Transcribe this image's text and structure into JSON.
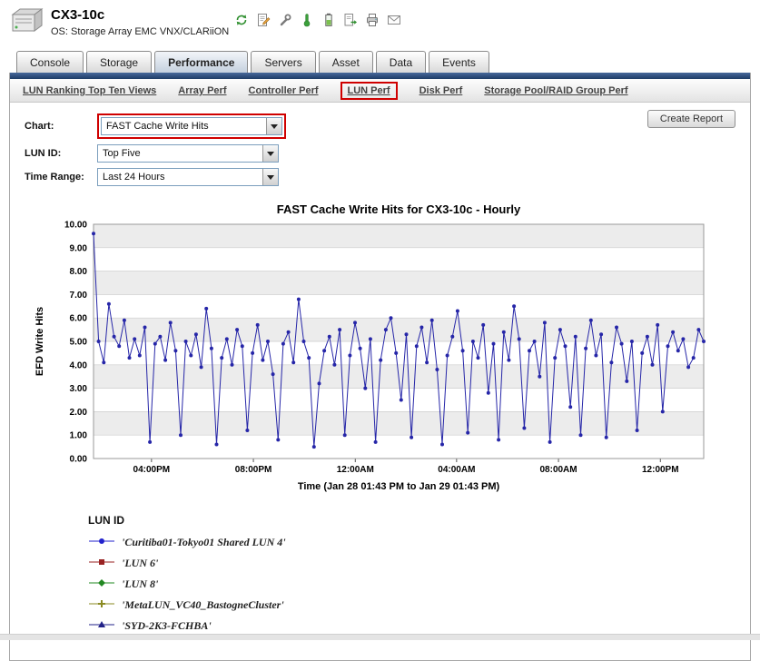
{
  "header": {
    "title": "CX3-10c",
    "subtitle": "OS: Storage Array EMC VNX/CLARiiON",
    "toolbar_icons": [
      "refresh-icon",
      "edit-report-icon",
      "tools-icon",
      "thermometer-icon",
      "battery-icon",
      "export-icon",
      "print-icon",
      "email-icon"
    ]
  },
  "tabs": [
    {
      "label": "Console",
      "active": false
    },
    {
      "label": "Storage",
      "active": false
    },
    {
      "label": "Performance",
      "active": true
    },
    {
      "label": "Servers",
      "active": false
    },
    {
      "label": "Asset",
      "active": false
    },
    {
      "label": "Data",
      "active": false
    },
    {
      "label": "Events",
      "active": false
    }
  ],
  "subnav": [
    {
      "label": "LUN Ranking Top Ten Views",
      "callout": false
    },
    {
      "label": "Array Perf",
      "callout": false
    },
    {
      "label": "Controller Perf",
      "callout": false
    },
    {
      "label": "LUN Perf",
      "callout": true
    },
    {
      "label": "Disk Perf",
      "callout": false
    },
    {
      "label": "Storage Pool/RAID Group Perf",
      "callout": false
    }
  ],
  "controls": {
    "rows": [
      {
        "name": "chart",
        "label": "Chart:",
        "value": "FAST Cache Write Hits",
        "callout": true
      },
      {
        "name": "lun-id",
        "label": "LUN ID:",
        "value": "Top Five",
        "callout": false
      },
      {
        "name": "time-range",
        "label": "Time Range:",
        "value": "Last 24 Hours",
        "callout": false
      }
    ],
    "create_report_label": "Create Report"
  },
  "chart_data": {
    "type": "line",
    "title": "FAST Cache Write Hits for CX3-10c - Hourly",
    "xlabel": "Time (Jan 28 01:43 PM to Jan 29 01:43 PM)",
    "ylabel": "EFD Write Hits",
    "ylim": [
      0,
      10
    ],
    "ytick_step": 1,
    "grid": true,
    "x_ticks": [
      {
        "label": "04:00PM",
        "pos": 0.095
      },
      {
        "label": "08:00PM",
        "pos": 0.262
      },
      {
        "label": "12:00AM",
        "pos": 0.429
      },
      {
        "label": "04:00AM",
        "pos": 0.595
      },
      {
        "label": "08:00AM",
        "pos": 0.762
      },
      {
        "label": "12:00PM",
        "pos": 0.929
      }
    ],
    "series": [
      {
        "name": "'Curitiba01-Tokyo01 Shared LUN 4'",
        "color": "#2626a8",
        "values": [
          9.6,
          5.0,
          4.1,
          6.6,
          5.2,
          4.8,
          5.9,
          4.3,
          5.1,
          4.4,
          5.6,
          0.7,
          4.9,
          5.2,
          4.2,
          5.8,
          4.6,
          1.0,
          5.0,
          4.4,
          5.3,
          3.9,
          6.4,
          4.7,
          0.6,
          4.3,
          5.1,
          4.0,
          5.5,
          4.8,
          1.2,
          4.5,
          5.7,
          4.2,
          5.0,
          3.6,
          0.8,
          4.9,
          5.4,
          4.1,
          6.8,
          5.0,
          4.3,
          0.5,
          3.2,
          4.6,
          5.2,
          4.0,
          5.5,
          1.0,
          4.4,
          5.8,
          4.7,
          3.0,
          5.1,
          0.7,
          4.2,
          5.5,
          6.0,
          4.5,
          2.5,
          5.3,
          0.9,
          4.8,
          5.6,
          4.1,
          5.9,
          3.8,
          0.6,
          4.4,
          5.2,
          6.3,
          4.6,
          1.1,
          5.0,
          4.3,
          5.7,
          2.8,
          4.9,
          0.8,
          5.4,
          4.2,
          6.5,
          5.1,
          1.3,
          4.6,
          5.0,
          3.5,
          5.8,
          0.7,
          4.3,
          5.5,
          4.8,
          2.2,
          5.2,
          1.0,
          4.7,
          5.9,
          4.4,
          5.3,
          0.9,
          4.1,
          5.6,
          4.9,
          3.3,
          5.0,
          1.2,
          4.5,
          5.2,
          4.0,
          5.7,
          2.0,
          4.8,
          5.4,
          4.6,
          5.1,
          3.9,
          4.3,
          5.5,
          5.0
        ]
      }
    ],
    "legend": {
      "title": "LUN ID",
      "position": "bottom-left",
      "entries": [
        {
          "label": "'Curitiba01-Tokyo01 Shared LUN 4'",
          "color": "#2222cc",
          "shape": "circle"
        },
        {
          "label": "'LUN 6'",
          "color": "#992222",
          "shape": "square"
        },
        {
          "label": "'LUN 8'",
          "color": "#228822",
          "shape": "diamond"
        },
        {
          "label": "'MetaLUN_VC40_BastogneCluster'",
          "color": "#8a8a22",
          "shape": "cross"
        },
        {
          "label": "'SYD-2K3-FCHBA'",
          "color": "#222288",
          "shape": "triangle"
        }
      ]
    }
  }
}
